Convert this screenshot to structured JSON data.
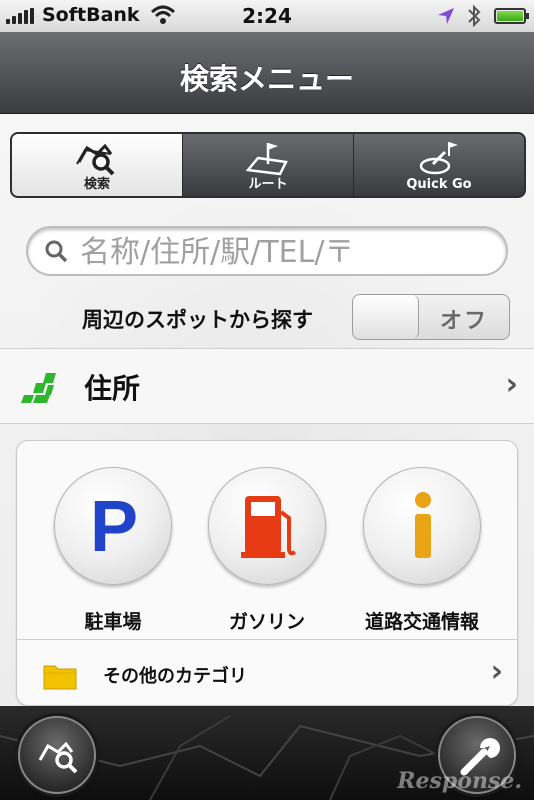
{
  "status_bar": {
    "carrier": "SoftBank",
    "time": "2:24",
    "icons": [
      "signal-icon",
      "wifi-icon",
      "location-icon",
      "bluetooth-icon",
      "battery-icon"
    ]
  },
  "nav": {
    "title": "検索メニュー"
  },
  "segments": [
    {
      "label": "検索",
      "icon": "search-map-icon",
      "selected": true
    },
    {
      "label": "ルート",
      "icon": "route-flag-icon",
      "selected": false
    },
    {
      "label": "Quick Go",
      "icon": "quick-go-icon",
      "selected": false
    }
  ],
  "search": {
    "placeholder": "名称/住所/駅/TEL/〒",
    "value": ""
  },
  "nearby": {
    "label": "周辺のスポットから探す",
    "toggle_state": "オフ"
  },
  "address_row": {
    "label": "住所",
    "chevron": "›"
  },
  "categories": [
    {
      "label": "駐車場",
      "icon": "parking-icon"
    },
    {
      "label": "ガソリン",
      "icon": "gas-pump-icon"
    },
    {
      "label": "道路交通情報",
      "icon": "info-icon"
    }
  ],
  "other_categories": {
    "label": "その他のカテゴリ",
    "chevron": "›"
  },
  "toolbar": {
    "icons": [
      "search-map-icon",
      "wrench-icon"
    ]
  },
  "watermark": "Response.",
  "colors": {
    "accent_green": "#2fb52f",
    "parking_blue": "#1f44c9",
    "gas_red": "#e63b14",
    "info_orange": "#e8a317"
  }
}
